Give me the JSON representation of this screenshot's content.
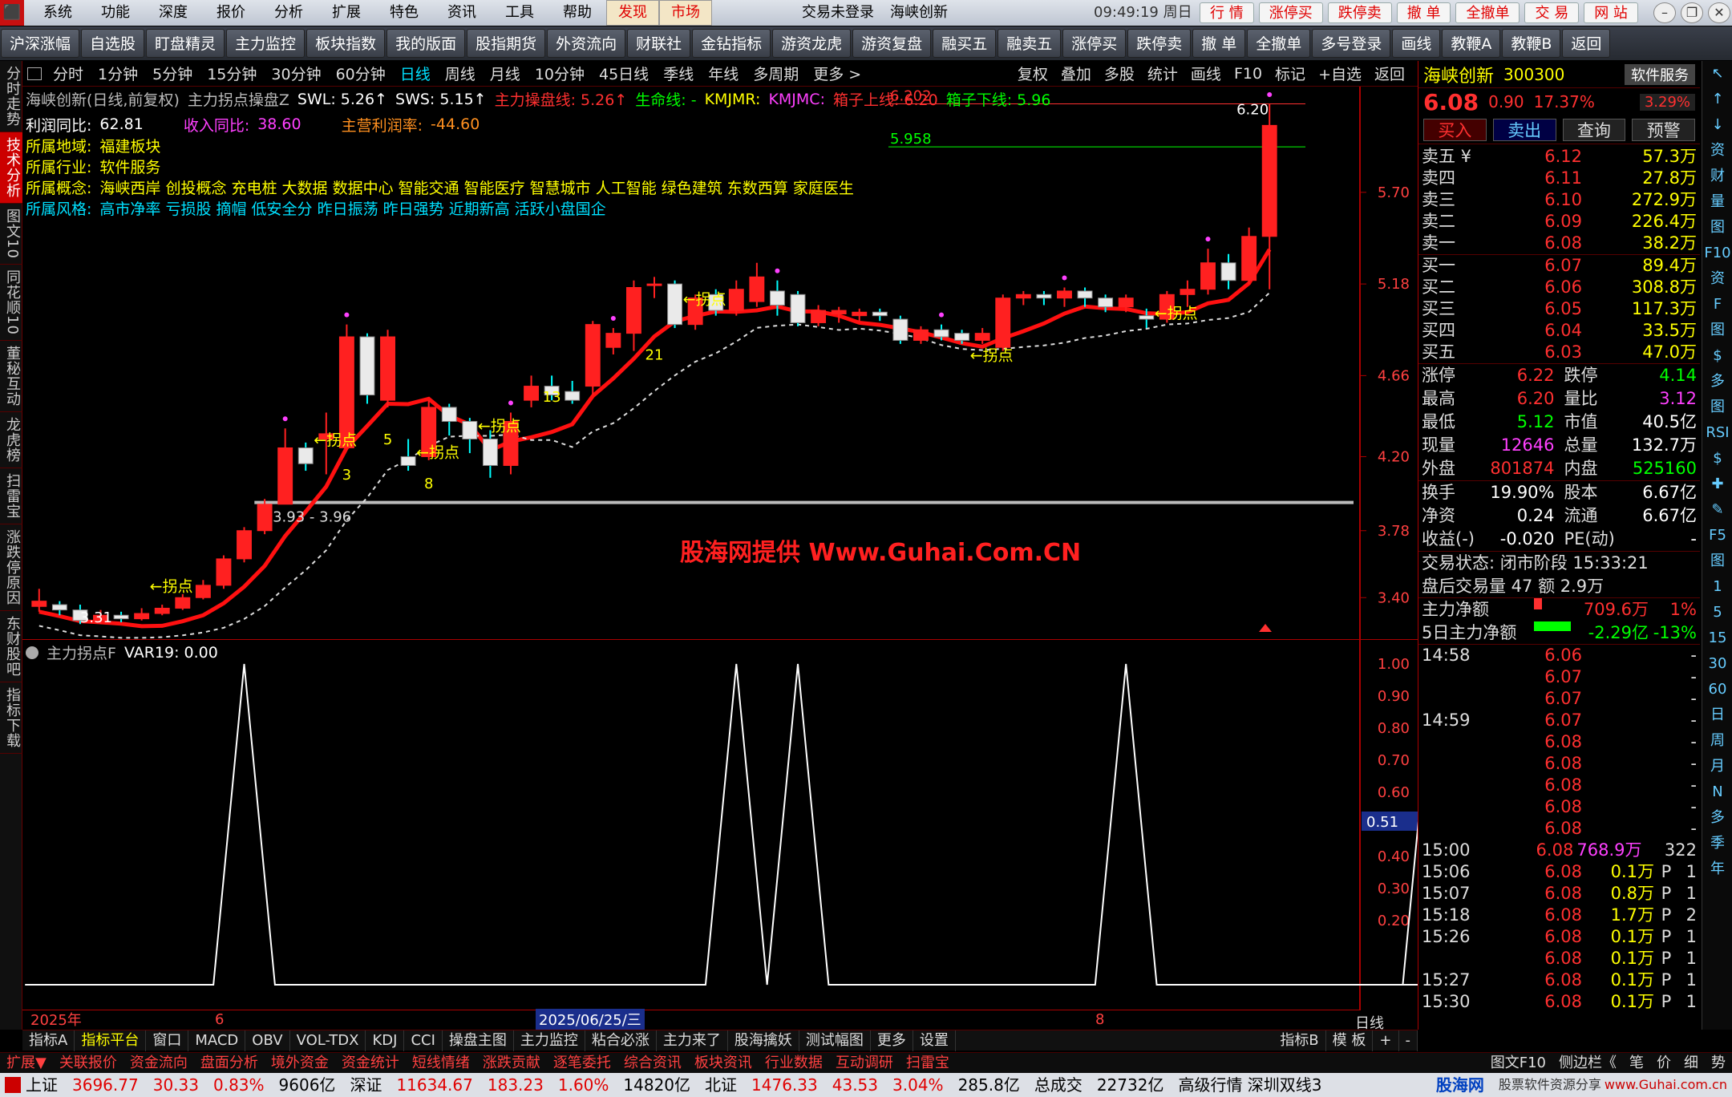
{
  "menu": {
    "items": [
      "系统",
      "功能",
      "深度",
      "报价",
      "分析",
      "扩展",
      "特色",
      "资讯",
      "工具",
      "帮助"
    ],
    "discover": "发现",
    "market": "市场",
    "login_status": "交易未登录",
    "window_title": "海峡创新",
    "clock": "09:49:19 周日",
    "quick_buttons": [
      "行 情",
      "涨停买",
      "跌停卖",
      "撤 单",
      "全撤单",
      "交 易",
      "网 站"
    ]
  },
  "toolbar": [
    "沪深涨幅",
    "自选股",
    "盯盘精灵",
    "主力监控",
    "板块指数",
    "我的版面",
    "股指期货",
    "外资流向",
    "财联社",
    "金钻指标",
    "游资龙虎",
    "游资复盘",
    "融买五",
    "融卖五",
    "涨停买",
    "跌停卖",
    "撤 单",
    "全撤单",
    "多号登录",
    "画线",
    "教鞭A",
    "教鞭B",
    "返回"
  ],
  "left_tabs": [
    "分时走势",
    "技术分析",
    "图文10",
    "同花顺10",
    "董秘互动",
    "龙虎榜",
    "扫雷宝",
    "涨跌停原因",
    "东财股吧",
    "指标下载"
  ],
  "period_bar": {
    "periods": [
      "分时",
      "1分钟",
      "5分钟",
      "15分钟",
      "30分钟",
      "60分钟",
      "日线",
      "周线",
      "月线",
      "10分钟",
      "45日线",
      "季线",
      "年线",
      "多周期",
      "更多 >"
    ],
    "tools": [
      "复权",
      "叠加",
      "多股",
      "统计",
      "画线",
      "F10",
      "标记",
      "+自选",
      "返回"
    ]
  },
  "chart_header": {
    "stock": "海峡创新(日线,前复权)",
    "indicator": "主力拐点操盘Z",
    "swl": "SWL: 5.26↑",
    "sws": "SWS: 5.15↑",
    "main_line": "主力操盘线: 5.26↑",
    "life_line": "生命线: -",
    "kmjmr": "KMJMR:",
    "kmjmc": "KMJMC:",
    "upper": "箱子上线: 6.20",
    "lower": "箱子下线: 5.96"
  },
  "fundamentals": {
    "profit_yoy_label": "利润同比:",
    "profit_yoy": "62.81",
    "revenue_yoy_label": "收入同比:",
    "revenue_yoy": "38.60",
    "main_profit_label": "主营利润率:",
    "main_profit": "-44.60",
    "region_label": "所属地域:",
    "region": "福建板块",
    "industry_label": "所属行业:",
    "industry": "软件服务",
    "concept_label": "所属概念:",
    "concept": "海峡西岸 创投概念 充电桩 大数据 数据中心 智能交通 智能医疗 智慧城市 人工智能 绿色建筑 东数西算 家庭医生",
    "style_label": "所属风格:",
    "style": "高市净率 亏损股 摘帽 低安全分 昨日振荡 昨日强势 近期新高 活跃小盘国企"
  },
  "chart_data": {
    "type": "candlestick",
    "y_ticks": [
      5.7,
      5.18,
      4.66,
      4.2,
      3.78,
      3.4
    ],
    "ylim": [
      3.16,
      6.3
    ],
    "candles": [
      [
        3.35,
        3.38,
        3.32,
        3.45
      ],
      [
        3.36,
        3.33,
        3.3,
        3.38
      ],
      [
        3.33,
        3.27,
        3.25,
        3.36
      ],
      [
        3.27,
        3.3,
        3.25,
        3.33
      ],
      [
        3.3,
        3.28,
        3.26,
        3.32
      ],
      [
        3.28,
        3.31,
        3.27,
        3.34
      ],
      [
        3.31,
        3.34,
        3.3,
        3.36
      ],
      [
        3.34,
        3.4,
        3.33,
        3.42
      ],
      [
        3.4,
        3.47,
        3.39,
        3.5
      ],
      [
        3.47,
        3.62,
        3.45,
        3.64
      ],
      [
        3.62,
        3.78,
        3.6,
        3.8
      ],
      [
        3.78,
        3.93,
        3.76,
        3.96
      ],
      [
        3.93,
        4.25,
        3.93,
        4.36
      ],
      [
        4.25,
        4.16,
        4.12,
        4.28
      ],
      [
        4.3,
        4.33,
        4.1,
        4.45
      ],
      [
        4.25,
        4.88,
        4.25,
        4.95
      ],
      [
        4.88,
        4.55,
        4.5,
        4.9
      ],
      [
        4.52,
        4.88,
        4.48,
        4.92
      ],
      [
        4.2,
        4.15,
        4.12,
        4.3
      ],
      [
        4.2,
        4.48,
        4.18,
        4.52
      ],
      [
        4.48,
        4.4,
        4.32,
        4.5
      ],
      [
        4.4,
        4.3,
        4.22,
        4.42
      ],
      [
        4.3,
        4.15,
        4.08,
        4.35
      ],
      [
        4.15,
        4.4,
        4.1,
        4.45
      ],
      [
        4.52,
        4.6,
        4.48,
        4.66
      ],
      [
        4.6,
        4.55,
        4.52,
        4.66
      ],
      [
        4.57,
        4.52,
        4.5,
        4.63
      ],
      [
        4.6,
        4.95,
        4.55,
        4.97
      ],
      [
        4.82,
        4.9,
        4.78,
        4.93
      ],
      [
        4.9,
        5.16,
        4.8,
        5.2
      ],
      [
        5.18,
        5.18,
        5.1,
        5.22
      ],
      [
        5.18,
        4.95,
        4.93,
        5.2
      ],
      [
        4.95,
        5.1,
        4.92,
        5.12
      ],
      [
        5.12,
        5.03,
        5.0,
        5.15
      ],
      [
        5.03,
        5.15,
        5.0,
        5.2
      ],
      [
        5.08,
        5.22,
        5.05,
        5.3
      ],
      [
        5.14,
        5.06,
        5.0,
        5.2
      ],
      [
        5.12,
        4.96,
        4.94,
        5.14
      ],
      [
        4.96,
        5.03,
        4.94,
        5.06
      ],
      [
        5.01,
        5.03,
        4.96,
        5.05
      ],
      [
        5.0,
        5.02,
        4.97,
        5.04
      ],
      [
        5.02,
        5.0,
        4.97,
        5.04
      ],
      [
        4.98,
        4.86,
        4.84,
        5.0
      ],
      [
        4.86,
        4.92,
        4.84,
        4.94
      ],
      [
        4.92,
        4.88,
        4.86,
        4.95
      ],
      [
        4.9,
        4.86,
        4.84,
        4.92
      ],
      [
        4.86,
        4.9,
        4.84,
        4.93
      ],
      [
        4.82,
        5.1,
        4.8,
        5.12
      ],
      [
        5.1,
        5.12,
        5.06,
        5.14
      ],
      [
        5.12,
        5.1,
        5.06,
        5.14
      ],
      [
        5.1,
        5.14,
        5.05,
        5.16
      ],
      [
        5.14,
        5.1,
        5.05,
        5.16
      ],
      [
        5.1,
        5.05,
        5.02,
        5.12
      ],
      [
        5.05,
        5.1,
        5.02,
        5.12
      ],
      [
        5.0,
        4.98,
        4.93,
        5.04
      ],
      [
        4.98,
        5.12,
        4.96,
        5.14
      ],
      [
        5.12,
        5.15,
        5.05,
        5.2
      ],
      [
        5.15,
        5.3,
        5.12,
        5.38
      ],
      [
        5.3,
        5.2,
        5.15,
        5.35
      ],
      [
        5.2,
        5.45,
        5.18,
        5.5
      ],
      [
        5.45,
        6.08,
        5.15,
        6.2
      ]
    ],
    "turning_points": [
      "←拐点",
      "←拐点",
      "←拐点",
      "←拐点",
      "←拐点",
      "←拐点",
      "←拐点"
    ],
    "count_labels": [
      "3",
      "5",
      "8",
      "13",
      "21"
    ],
    "price_labels": [
      "3.31",
      "3.93 - 3.96",
      "6.202",
      "5.958",
      "6.20"
    ],
    "sub_indicator": {
      "name": "主力拐点F",
      "var": "VAR19: 0.00",
      "y_ticks": [
        1.0,
        0.9,
        0.8,
        0.7,
        0.6,
        0.5,
        0.4,
        0.3,
        0.2
      ],
      "current": "0.51",
      "spikes": [
        10,
        34,
        37,
        53,
        68,
        80
      ]
    },
    "x_labels": [
      "2025年",
      "6",
      "2025/06/25/三",
      "8"
    ]
  },
  "watermark": "股海网提供 Www.Guhai.Com.CN",
  "quote": {
    "name": "海峡创新",
    "code": "300300",
    "service": "软件服务",
    "pct_badge": "3.29%",
    "price": "6.08",
    "change": "0.90",
    "pct": "17.37%",
    "buttons": [
      "买入",
      "卖出",
      "查询",
      "预警"
    ],
    "sells": [
      [
        "卖五 ¥",
        "6.12",
        "57.3万"
      ],
      [
        "卖四",
        "6.11",
        "27.8万"
      ],
      [
        "卖三",
        "6.10",
        "272.9万"
      ],
      [
        "卖二",
        "6.09",
        "226.4万"
      ],
      [
        "卖一",
        "6.08",
        "38.2万"
      ]
    ],
    "buys": [
      [
        "买一",
        "6.07",
        "89.4万"
      ],
      [
        "买二",
        "6.06",
        "308.8万"
      ],
      [
        "买三",
        "6.05",
        "117.3万"
      ],
      [
        "买四",
        "6.04",
        "33.5万"
      ],
      [
        "买五",
        "6.03",
        "47.0万"
      ]
    ],
    "stats": [
      [
        "涨停",
        "6.22",
        "跌停",
        "4.14"
      ],
      [
        "最高",
        "6.20",
        "量比",
        "3.12"
      ],
      [
        "最低",
        "5.12",
        "市值",
        "40.5亿"
      ],
      [
        "现量",
        "12646",
        "总量",
        "132.7万"
      ],
      [
        "外盘",
        "801874",
        "内盘",
        "525160"
      ]
    ],
    "stats2": [
      [
        "换手",
        "19.90%",
        "股本",
        "6.67亿"
      ],
      [
        "净资",
        "0.24",
        "流通",
        "6.67亿"
      ],
      [
        "收益(-)",
        "-0.020",
        "PE(动)",
        "-"
      ]
    ],
    "trade_status": "交易状态: 闭市阶段 15:33:21",
    "after_hours": "盘后交易量 47 额 2.9万",
    "net_main_label": "主力净额",
    "net_main": "709.6万",
    "net_main_pct": "1%",
    "net5_label": "5日主力净额",
    "net5": "-2.29亿",
    "net5_pct": "-13%",
    "ticks": [
      [
        "14:58",
        "6.06",
        "",
        "",
        "-"
      ],
      [
        "",
        "6.07",
        "",
        "",
        "-"
      ],
      [
        "",
        "6.07",
        "",
        "",
        "-"
      ],
      [
        "14:59",
        "6.07",
        "",
        "",
        "-"
      ],
      [
        "",
        "6.08",
        "",
        "",
        "-"
      ],
      [
        "",
        "6.08",
        "",
        "",
        "-"
      ],
      [
        "",
        "6.08",
        "",
        "",
        "-"
      ],
      [
        "",
        "6.08",
        "",
        "",
        "-"
      ],
      [
        "",
        "6.08",
        "",
        "",
        "-"
      ],
      [
        "15:00",
        "6.08",
        "768.9万",
        "",
        "322"
      ],
      [
        "15:06",
        "6.08",
        "0.1万",
        "P",
        "1"
      ],
      [
        "15:07",
        "6.08",
        "0.8万",
        "P",
        "1"
      ],
      [
        "15:18",
        "6.08",
        "1.7万",
        "P",
        "2"
      ],
      [
        "15:26",
        "6.08",
        "0.1万",
        "P",
        "1"
      ],
      [
        "",
        "6.08",
        "0.1万",
        "P",
        "1"
      ],
      [
        "15:27",
        "6.08",
        "0.1万",
        "P",
        "1"
      ],
      [
        "15:30",
        "6.08",
        "0.1万",
        "P",
        "1"
      ]
    ]
  },
  "right_icons": [
    "↖",
    "↑",
    "↓",
    "资",
    "财",
    "量",
    "图",
    "F10",
    "资",
    "F",
    "图",
    "$",
    "多",
    "图",
    "RSI",
    "$",
    "✚",
    "✎",
    "F5",
    "图",
    "1",
    "5",
    "15",
    "30",
    "60",
    "日",
    "周",
    "月",
    "N",
    "多",
    "季",
    "年"
  ],
  "indicator_tabs": [
    "指标A",
    "指标平台",
    "窗口",
    "MACD",
    "OBV",
    "VOL-TDX",
    "KDJ",
    "CCI",
    "操盘主图",
    "主力监控",
    "粘合必涨",
    "主力来了",
    "股海擒妖",
    "测试幅图",
    "更多",
    "设置"
  ],
  "indicator_tabs_right": [
    "指标B",
    "模 板",
    "+",
    "-"
  ],
  "ext_bar": [
    "扩展▼",
    "关联报价",
    "资金流向",
    "盘面分析",
    "境外资金",
    "资金统计",
    "短线情绪",
    "涨跌贡献",
    "逐笔委托",
    "综合资讯",
    "板块资讯",
    "行业数据",
    "互动调研",
    "扫雷宝"
  ],
  "ext_right": [
    "图文F10",
    "侧边栏《",
    "笔",
    "价",
    "细",
    "势"
  ],
  "status": {
    "sh_label": "上证",
    "sh": "3696.77",
    "sh_chg": "30.33",
    "sh_pct": "0.83%",
    "sh_amt": "9606亿",
    "sz_label": "深证",
    "sz": "11634.67",
    "sz_chg": "183.23",
    "sz_pct": "1.60%",
    "sz_amt": "14820亿",
    "bz_label": "北证",
    "bz": "1476.33",
    "bz_chg": "43.53",
    "bz_pct": "3.04%",
    "bz_amt": "285.8亿",
    "total_label": "总成交",
    "total": "22732亿",
    "feed": "高级行情 深圳双线3",
    "brand": "股海网",
    "brand_sub": "股票软件资源分享",
    "brand_url": "www.Guhai.com.cn"
  },
  "day_label": "日线"
}
